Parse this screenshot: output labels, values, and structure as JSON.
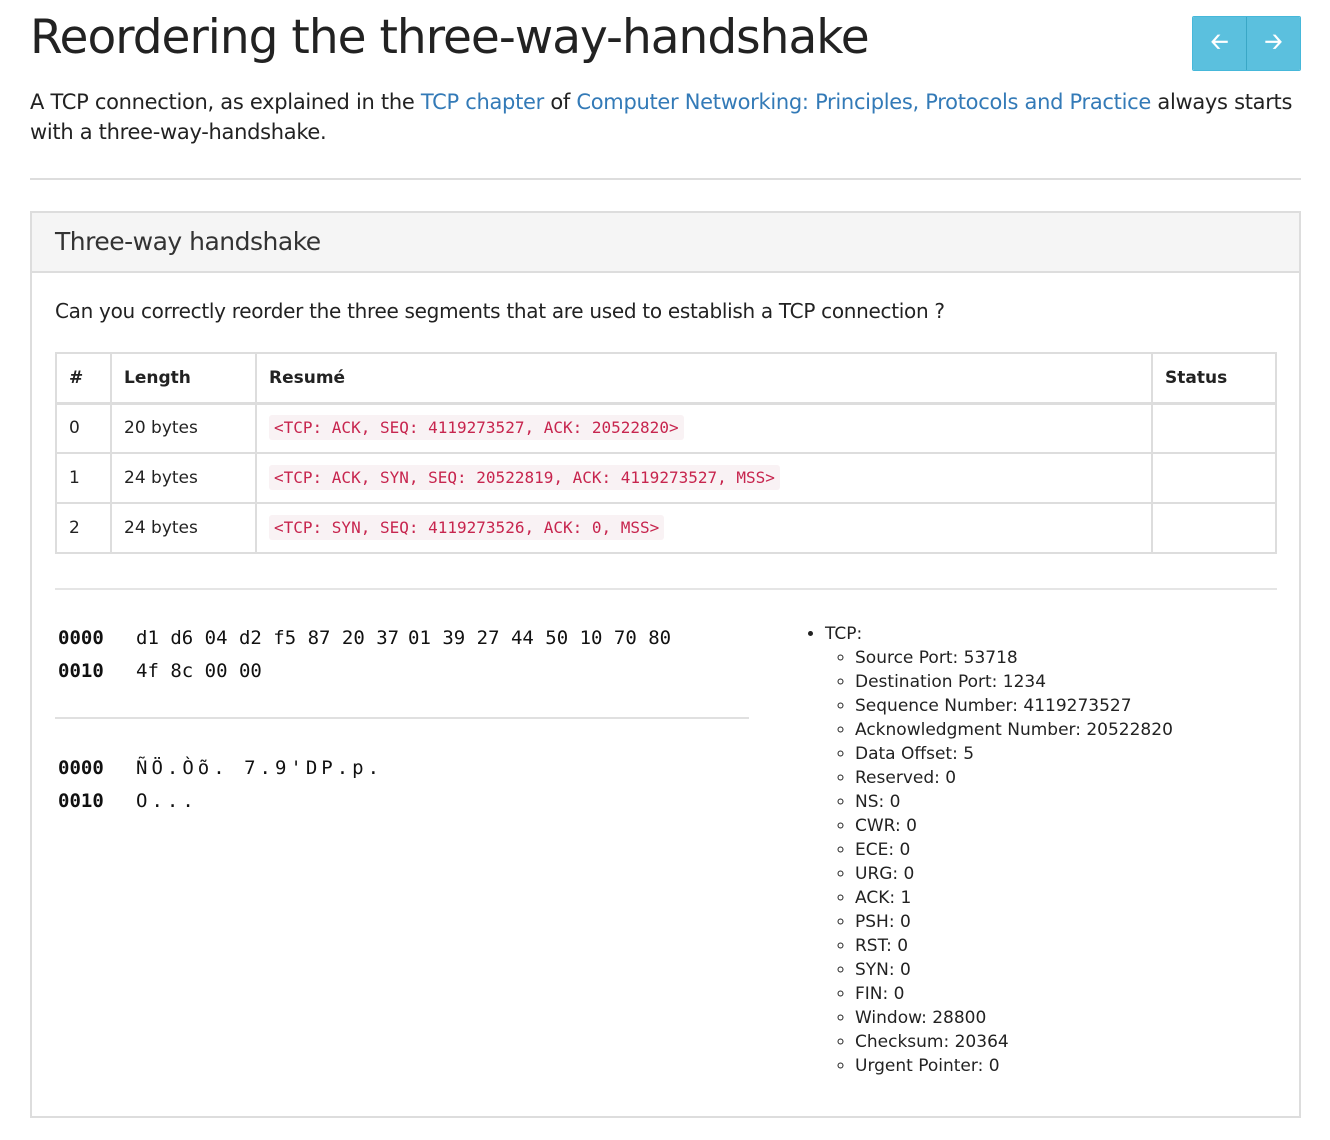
{
  "page": {
    "title": "Reordering the three-way-handshake",
    "intro": {
      "text_1": "A TCP connection, as explained in the ",
      "link_1": "TCP chapter",
      "text_2": " of ",
      "link_2": "Computer Networking: Principles, Protocols and Practice",
      "text_3": " always starts with a three-way-handshake."
    }
  },
  "nav": {
    "prev_icon": "arrow-left-icon",
    "next_icon": "arrow-right-icon",
    "prev_glyph": "🡠",
    "next_glyph": "🡢"
  },
  "panel": {
    "heading": "Three-way handshake",
    "question": "Can you correctly reorder the three segments that are used to establish a TCP connection ?"
  },
  "table": {
    "headers": [
      "#",
      "Length",
      "Resumé",
      "Status"
    ],
    "rows": [
      {
        "num": "0",
        "length": "20 bytes",
        "resume": "<TCP: ACK, SEQ: 4119273527, ACK: 20522820>",
        "status": ""
      },
      {
        "num": "1",
        "length": "24 bytes",
        "resume": "<TCP: ACK, SYN, SEQ: 20522819, ACK: 4119273527, MSS>",
        "status": ""
      },
      {
        "num": "2",
        "length": "24 bytes",
        "resume": "<TCP: SYN, SEQ: 4119273526, ACK: 0, MSS>",
        "status": ""
      }
    ]
  },
  "hexdump": {
    "lines": [
      {
        "offset": "0000",
        "bytes_a": "d1 d6 04 d2 f5 87 20 37",
        "bytes_b": "01 39 27 44 50 10 70 80"
      },
      {
        "offset": "0010",
        "bytes_a": "4f 8c 00 00",
        "bytes_b": ""
      }
    ]
  },
  "asciidump": {
    "lines": [
      {
        "offset": "0000",
        "text": "ÑÖ.Òõ. 7.9'DP.p."
      },
      {
        "offset": "0010",
        "text": "O..."
      }
    ]
  },
  "fields": {
    "root": "TCP:",
    "items": [
      "Source Port: 53718",
      "Destination Port: 1234",
      "Sequence Number: 4119273527",
      "Acknowledgment Number: 20522820",
      "Data Offset: 5",
      "Reserved: 0",
      "NS: 0",
      "CWR: 0",
      "ECE: 0",
      "URG: 0",
      "ACK: 1",
      "PSH: 0",
      "RST: 0",
      "SYN: 0",
      "FIN: 0",
      "Window: 28800",
      "Checksum: 20364",
      "Urgent Pointer: 0"
    ]
  },
  "colors": {
    "link": "#337ab7",
    "nav_button": "#5bc0de",
    "code_text": "#c7254e",
    "code_bg": "#f9f2f4"
  }
}
